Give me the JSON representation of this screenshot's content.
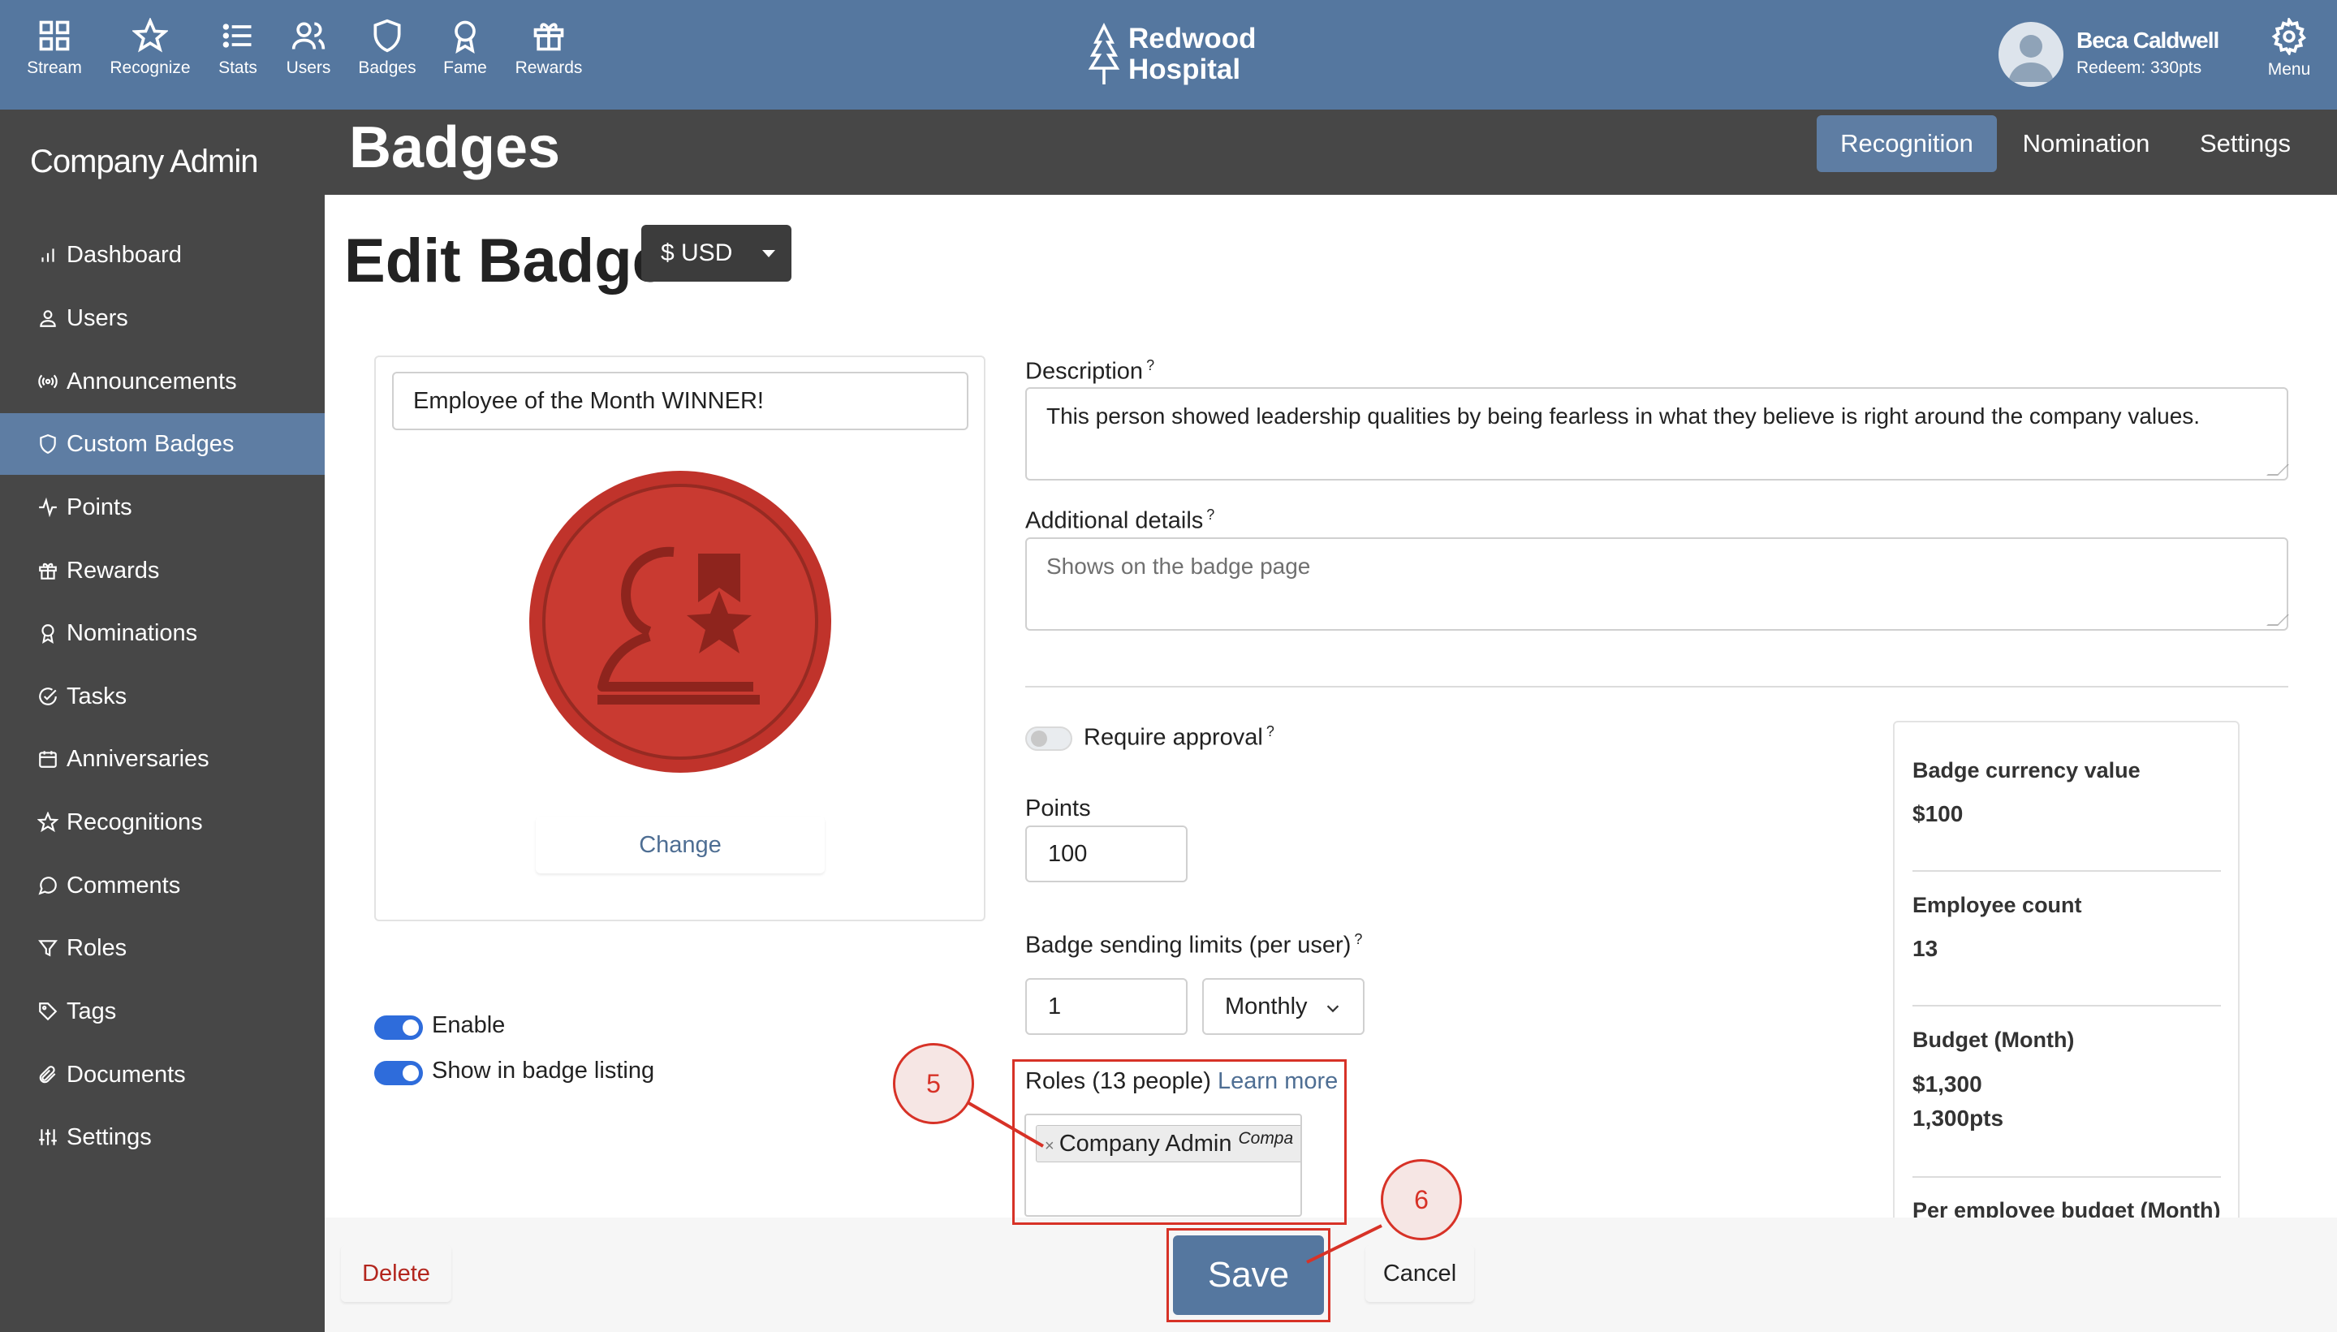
{
  "top_nav": [
    {
      "label": "Stream",
      "icon": "grid-icon"
    },
    {
      "label": "Recognize",
      "icon": "star-icon"
    },
    {
      "label": "Stats",
      "icon": "list-icon"
    },
    {
      "label": "Users",
      "icon": "users-icon"
    },
    {
      "label": "Badges",
      "icon": "shield-icon"
    },
    {
      "label": "Fame",
      "icon": "award-icon"
    },
    {
      "label": "Rewards",
      "icon": "gift-icon"
    }
  ],
  "brand": {
    "line1": "Redwood",
    "line2": "Hospital",
    "icon": "tree-icon"
  },
  "user": {
    "name": "Beca Caldwell",
    "redeem": "Redeem: 330pts"
  },
  "menu_label": "Menu",
  "sidebar": {
    "title": "Company Admin",
    "items": [
      {
        "label": "Dashboard",
        "icon": "bar-chart-icon"
      },
      {
        "label": "Users",
        "icon": "user-icon"
      },
      {
        "label": "Announcements",
        "icon": "broadcast-icon"
      },
      {
        "label": "Custom Badges",
        "icon": "shield-icon",
        "active": true
      },
      {
        "label": "Points",
        "icon": "activity-icon"
      },
      {
        "label": "Rewards",
        "icon": "gift-icon"
      },
      {
        "label": "Nominations",
        "icon": "award-icon"
      },
      {
        "label": "Tasks",
        "icon": "check-circle-icon"
      },
      {
        "label": "Anniversaries",
        "icon": "calendar-icon"
      },
      {
        "label": "Recognitions",
        "icon": "star-icon"
      },
      {
        "label": "Comments",
        "icon": "comment-icon"
      },
      {
        "label": "Roles",
        "icon": "filter-icon"
      },
      {
        "label": "Tags",
        "icon": "tag-icon"
      },
      {
        "label": "Documents",
        "icon": "paperclip-icon"
      },
      {
        "label": "Settings",
        "icon": "sliders-icon"
      }
    ]
  },
  "header": {
    "title": "Badges",
    "tabs": [
      {
        "label": "Recognition",
        "active": true
      },
      {
        "label": "Nomination",
        "active": false
      },
      {
        "label": "Settings",
        "active": false
      }
    ]
  },
  "edit": {
    "title": "Edit Badge",
    "currency": "$ USD",
    "badge_name": "Employee of the Month WINNER!",
    "change_label": "Change",
    "enable_label": "Enable",
    "enable_on": true,
    "listing_label": "Show in badge listing",
    "listing_on": true,
    "description_label": "Description",
    "description_value": "This person showed leadership qualities by being fearless in what they believe is right around the company values.",
    "details_label": "Additional details",
    "details_placeholder": "Shows on the badge page",
    "require_approval_label": "Require approval",
    "require_approval_on": false,
    "points_label": "Points",
    "points_value": "100",
    "limits_label": "Badge sending limits (per user)",
    "limit_value": "1",
    "limit_period": "Monthly",
    "roles_label": "Roles (13 people)",
    "learn_more": "Learn more",
    "role_tag": "Company Admin",
    "role_tag_sub": "Compa",
    "help_mark": "?"
  },
  "summary": [
    {
      "label": "Badge currency value",
      "values": [
        "$100"
      ]
    },
    {
      "label": "Employee count",
      "values": [
        "13"
      ]
    },
    {
      "label": "Budget (Month)",
      "values": [
        "$1,300",
        "1,300pts"
      ]
    },
    {
      "label": "Per employee budget (Month)",
      "values": []
    }
  ],
  "footer": {
    "delete": "Delete",
    "save": "Save",
    "cancel": "Cancel"
  },
  "callouts": [
    "5",
    "6"
  ],
  "colors": {
    "topbar": "#55779f",
    "sidebar": "#474747",
    "active": "#5e7da3",
    "badge_red": "#c0332b",
    "annotation": "#d73227",
    "toggle_on": "#2e6cdb"
  }
}
